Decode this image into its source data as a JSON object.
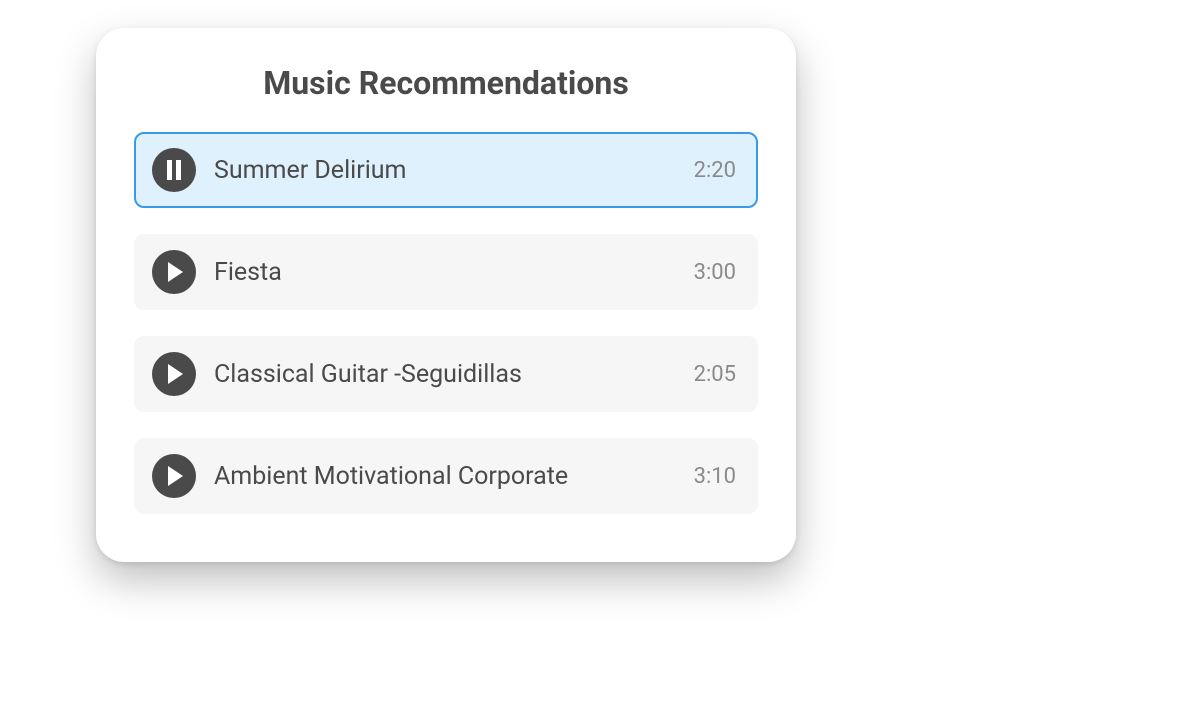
{
  "title": "Music Recommendations",
  "tracks": [
    {
      "title": "Summer Delirium",
      "duration": "2:20",
      "playing": true
    },
    {
      "title": "Fiesta",
      "duration": "3:00",
      "playing": false
    },
    {
      "title": "Classical Guitar -Seguidillas",
      "duration": "2:05",
      "playing": false
    },
    {
      "title": "Ambient Motivational Corporate",
      "duration": "3:10",
      "playing": false
    }
  ]
}
